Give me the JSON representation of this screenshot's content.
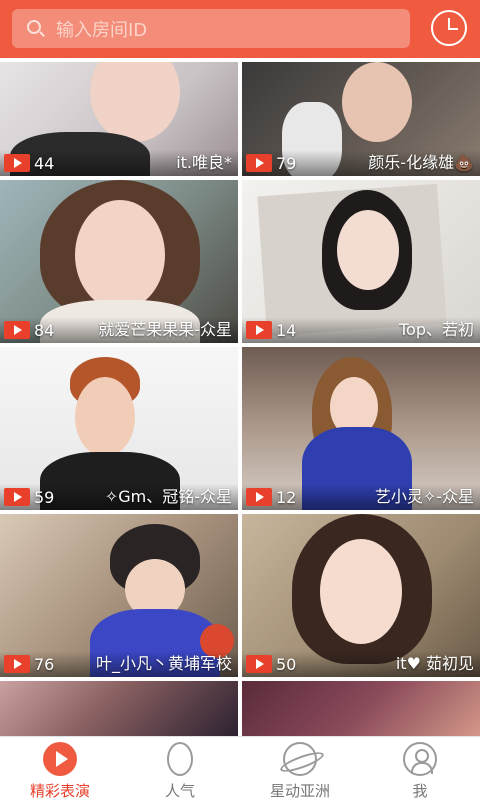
{
  "search": {
    "placeholder": "输入房间ID"
  },
  "icons": {
    "search": "search-icon",
    "history": "clock-icon",
    "play": "play-icon"
  },
  "colors": {
    "accent": "#f05a3f",
    "search_bg": "#f38c78",
    "badge": "#e8402a"
  },
  "rooms": [
    {
      "viewers": "44",
      "name": "it.唯良*"
    },
    {
      "viewers": "79",
      "name": "颜乐-化缘雄💩"
    },
    {
      "viewers": "84",
      "name": "就爱芒果果果-众星"
    },
    {
      "viewers": "14",
      "name": "Top、若初"
    },
    {
      "viewers": "59",
      "name": "✧Gm、冠铭-众星"
    },
    {
      "viewers": "12",
      "name": "艺小灵✧-众星"
    },
    {
      "viewers": "76",
      "name": "叶_小凡丶黄埔军校"
    },
    {
      "viewers": "50",
      "name": "it♥ 茹初见"
    }
  ],
  "tabs": [
    {
      "label": "精彩表演",
      "icon": "play-icon"
    },
    {
      "label": "人气",
      "icon": "flame-icon"
    },
    {
      "label": "星动亚洲",
      "icon": "planet-icon"
    },
    {
      "label": "我",
      "icon": "user-icon"
    }
  ]
}
